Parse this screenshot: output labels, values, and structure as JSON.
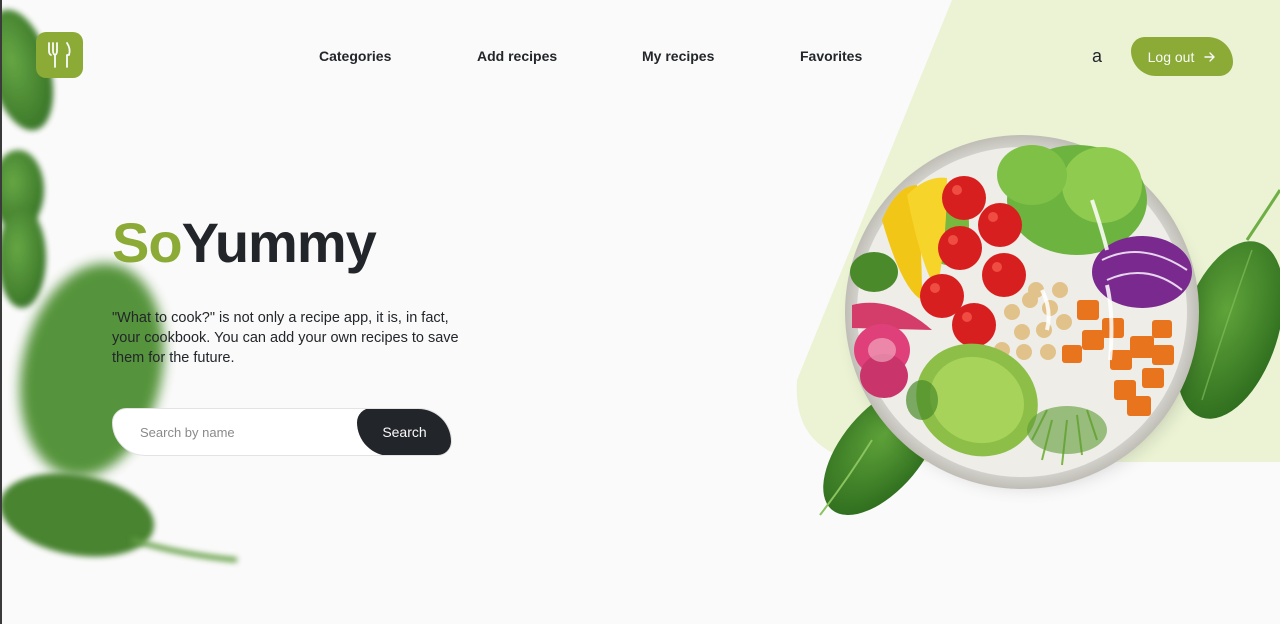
{
  "header": {
    "logo_icon": "fork-knife-icon",
    "nav": [
      {
        "label": "Categories"
      },
      {
        "label": "Add recipes"
      },
      {
        "label": "My recipes"
      },
      {
        "label": "Favorites"
      }
    ],
    "user_name": "a",
    "logout_label": "Log out",
    "logout_icon": "arrow-right-icon"
  },
  "hero": {
    "title_accent": "So",
    "title_rest": "Yummy",
    "description": "\"What to cook?\" is not only a recipe app, it is, in fact, your cookbook. You can add your own recipes to save them for the future.",
    "search": {
      "placeholder": "Search by name",
      "value": "",
      "button_label": "Search"
    }
  },
  "colors": {
    "accent": "#8BAA36",
    "dark": "#22252A",
    "background": "#FAFAFA",
    "light_green": "#EBF3D4"
  }
}
